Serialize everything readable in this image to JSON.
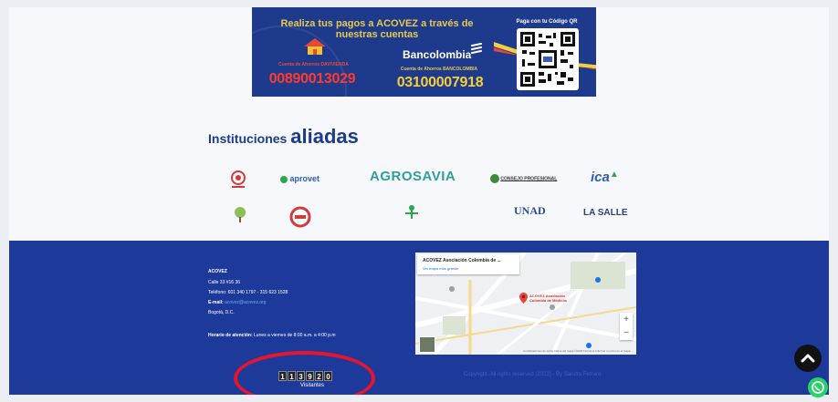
{
  "banner": {
    "title": "Realiza tus pagos a ACOVEZ a través de nuestras cuentas",
    "account1_label": "Cuenta de Ahorros DAVIVIENDA",
    "account1_number": "00890013029",
    "bank_name": "Bancolombia",
    "account2_label": "Cuenta de Ahorros BANCOLOMBIA",
    "account2_number": "03100007918",
    "qr_label": "Paga con tu Código QR"
  },
  "institutions": {
    "title_prefix": "Instituciones",
    "title_highlight": "aliadas",
    "partners": [
      "aprovet",
      "AGROSAVIA",
      "CONSEJO PROFESIONAL",
      "ica",
      "UNAD",
      "LA SALLE"
    ]
  },
  "footer": {
    "org": "ACOVEZ",
    "address": "Calle 33 #16 36",
    "phone": "Teléfono: 601 340 1797 - 315 623 1528",
    "email_label": "E-mail:",
    "email": "acovez@acovez.org",
    "city": "Bogotá, D.C.",
    "hours_label": "Horario de atención:",
    "hours": "Lunes a viernes de 8:00 a.m. a 4:00 p.m",
    "map_title": "ACOVEZ Asociación Colombia de ...",
    "map_link": "Ver mapa más grande",
    "map_pin_label": "ACOVEZ Asociación Colombia de Médicos",
    "map_footer": "Combinaciones de teclas  Datos del mapa ©2023  Términos  Informar un error en el mapa",
    "visitor_digits": [
      "1",
      "1",
      "3",
      "9",
      "2",
      "0"
    ],
    "visitors_label": "Visitantes",
    "copyright": "Copyright. All rights reserved (2022) - By Sandra Ferraro"
  },
  "colors": {
    "brand_blue": "#1d3a8c",
    "footer_blue": "#1d3a9a",
    "accent_red": "#e8142b",
    "whatsapp": "#25d366"
  }
}
